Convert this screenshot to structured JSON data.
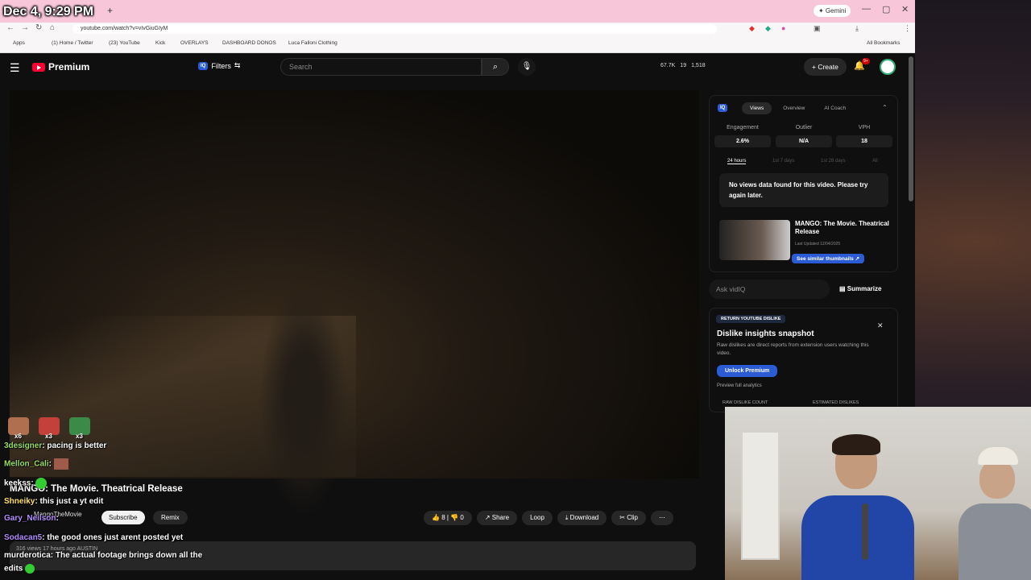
{
  "overlay": {
    "clock": "Dec 4, 9:29 PM"
  },
  "browser": {
    "new_tab": "+",
    "gemini": "✦ Gemini",
    "url": "youtube.com/watch?v=vIvGiuGIyM",
    "bookmarks": [
      "Apps",
      "(1) Home / Twitter",
      "(23) YouTube",
      "Kick",
      "OVERLAYS",
      "DASHBOARD DONOS",
      "Luca Falloni Clothing",
      "All Bookmarks"
    ]
  },
  "header": {
    "brand": "Premium",
    "filters": "Filters",
    "search_placeholder": "Search",
    "stats": [
      "67.7K",
      "19",
      "1,518"
    ],
    "create": "Create",
    "notifications": "9+"
  },
  "video": {
    "title": "MANGO: The Movie. Theatrical Release",
    "channel": "MangoTheMovie",
    "subscribe": "Subscribe",
    "remix": "Remix",
    "likes": "8",
    "dislikes": "0",
    "share": "Share",
    "loop": "Loop",
    "download": "Download",
    "clip": "Clip",
    "meta": "316 views  17 hours ago  AUSTIN"
  },
  "vidiq": {
    "tabs": [
      "Views",
      "Overview",
      "AI Coach"
    ],
    "metrics": [
      {
        "label": "Engagement",
        "value": "2.6%"
      },
      {
        "label": "Outlier",
        "value": "N/A"
      },
      {
        "label": "VPH",
        "value": "18"
      }
    ],
    "periods": [
      "24 hours",
      "1st 7 days",
      "1st 28 days",
      "All"
    ],
    "nodata": "No views data found for this video. Please try again later.",
    "thumb_title": "MANGO: The Movie. Theatrical Release",
    "last_updated": "Last Updated 12/04/2025",
    "similar": "See similar thumbnails ↗",
    "ask": "Ask vidIQ",
    "summarize": "Summarize"
  },
  "rtyd": {
    "label": "RETURN YOUTUBE DISLIKE",
    "title": "Dislike insights snapshot",
    "subtitle": "Raw dislikes are direct reports from extension users watching this video.",
    "unlock": "Unlock Premium",
    "preview": "Preview full analytics",
    "raw": "RAW DISLIKE COUNT",
    "est": "ESTIMATED DISLIKES"
  },
  "chat": {
    "emote_counts": [
      "x6",
      "x3",
      "x3"
    ],
    "messages": [
      {
        "user": "3designer",
        "text": "pacing is better",
        "color": "#9ade5c"
      },
      {
        "user": "Mellon_Cali",
        "text": "",
        "color": "#9ade5c"
      },
      {
        "user": "keekss",
        "text": "",
        "color": "#ffffff"
      },
      {
        "user": "Shneiky",
        "text": "this just a yt edit",
        "color": "#ffe066"
      },
      {
        "user": "Gary_Neilson",
        "text": "",
        "color": "#b58cff"
      },
      {
        "user": "Sodacan5",
        "text": "the good ones just arent posted yet",
        "color": "#b58cff"
      },
      {
        "user": "murderotica",
        "text": "The actual footage brings down all the",
        "color": "#ffffff"
      }
    ],
    "wrap": "edits"
  },
  "colors": {
    "accent": "#2c5bd6",
    "youtube_red": "#ff0033"
  }
}
